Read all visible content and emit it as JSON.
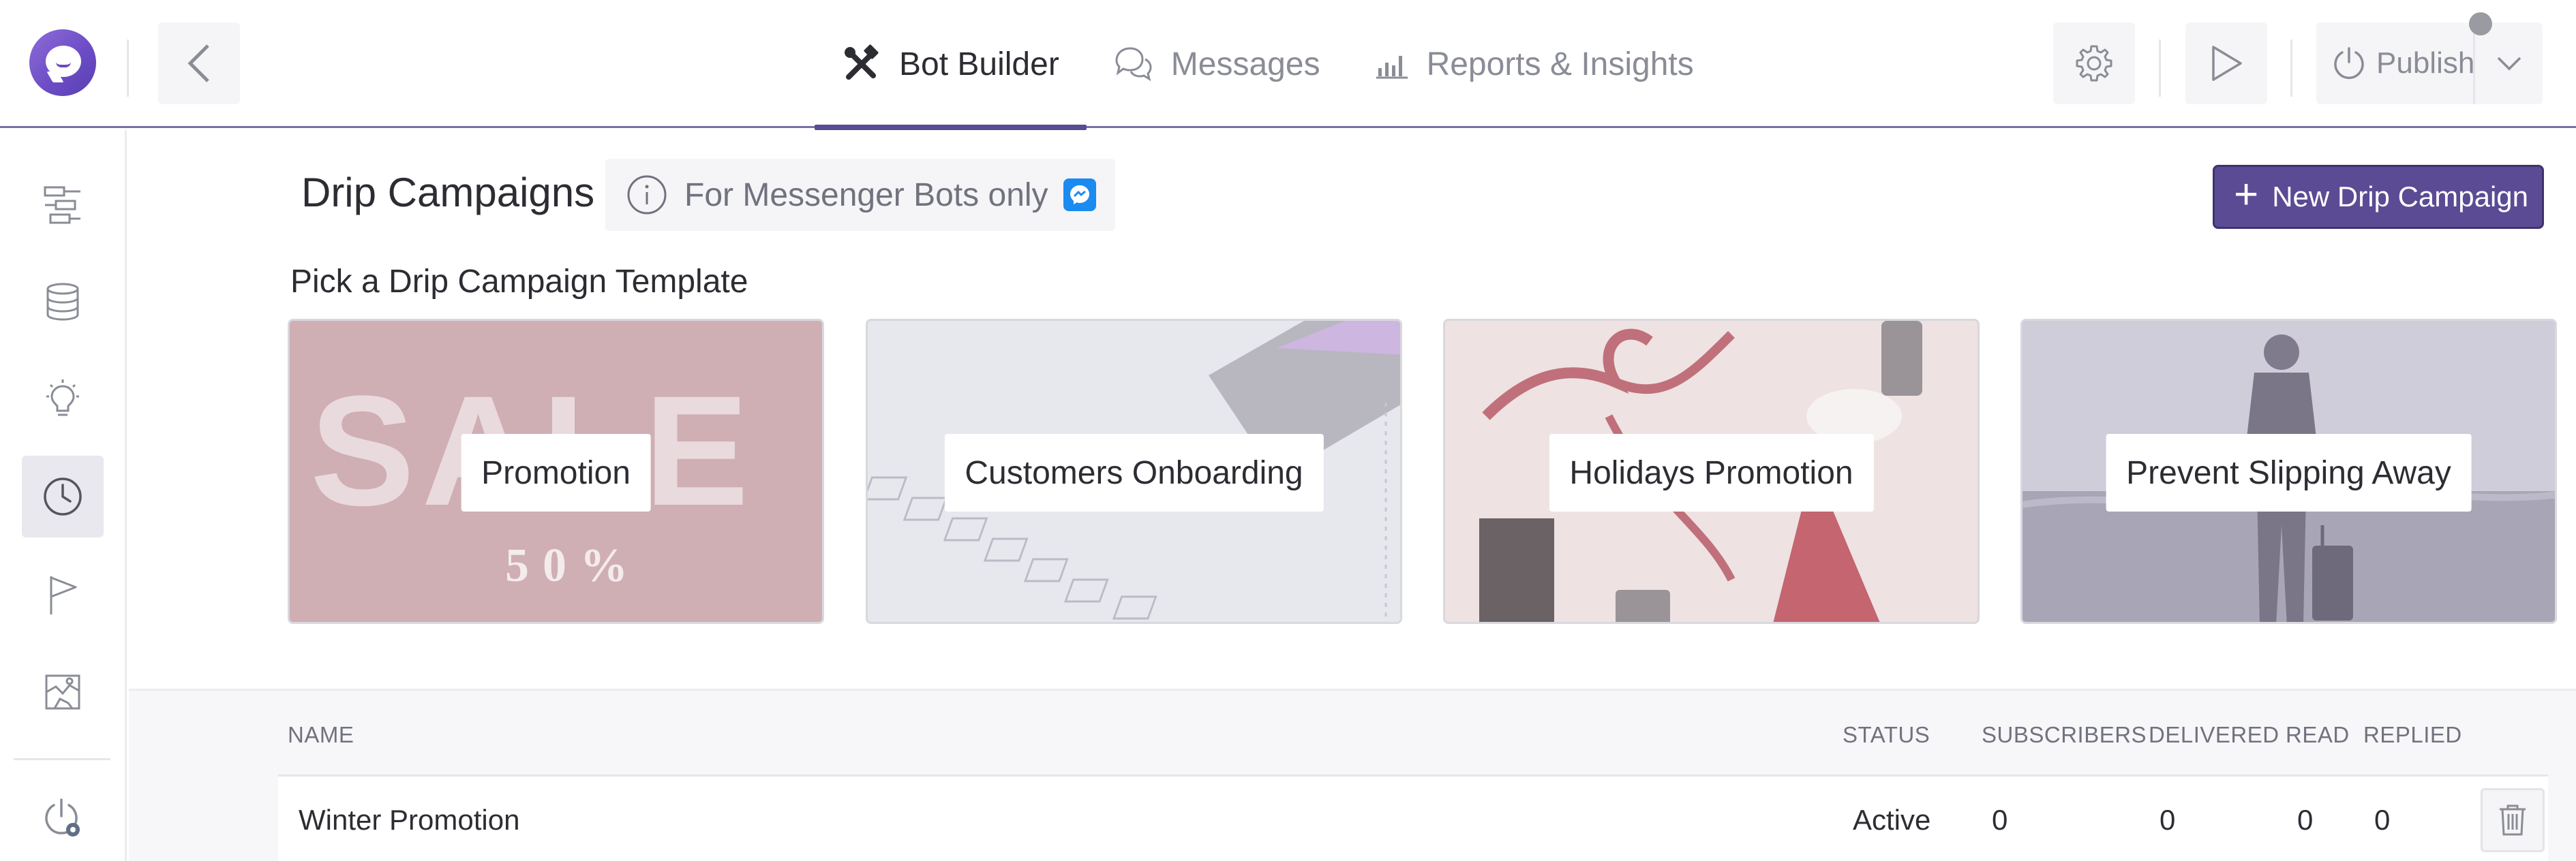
{
  "header": {
    "tabs": [
      {
        "label": "Bot Builder",
        "icon": "tools-icon",
        "active": true
      },
      {
        "label": "Messages",
        "icon": "chat-bubbles-icon",
        "active": false
      },
      {
        "label": "Reports & Insights",
        "icon": "bar-chart-icon",
        "active": false
      }
    ],
    "publish_label": "Publish"
  },
  "sidebar": {
    "items": [
      {
        "icon": "flow-icon",
        "active": false
      },
      {
        "icon": "database-icon",
        "active": false
      },
      {
        "icon": "lightbulb-icon",
        "active": false
      },
      {
        "icon": "clock-icon",
        "active": true
      },
      {
        "icon": "flag-icon",
        "active": false
      },
      {
        "icon": "map-icon",
        "active": false
      },
      {
        "icon": "power-settings-icon",
        "active": false
      }
    ]
  },
  "main": {
    "title": "Drip Campaigns",
    "info_text": "For Messenger Bots only",
    "new_button_label": "New Drip Campaign",
    "templates_heading": "Pick a Drip Campaign Template",
    "templates": [
      {
        "label": "Promotion"
      },
      {
        "label": "Customers Onboarding"
      },
      {
        "label": "Holidays Promotion"
      },
      {
        "label": "Prevent Slipping Away"
      }
    ],
    "template_art": {
      "sale_word": "SALE",
      "sale_percent": "50%"
    }
  },
  "table": {
    "columns": [
      "NAME",
      "STATUS",
      "SUBSCRIBERS",
      "DELIVERED",
      "READ",
      "REPLIED"
    ],
    "rows": [
      {
        "name": "Winter Promotion",
        "status": "Active",
        "subscribers": "0",
        "delivered": "0",
        "read": "0",
        "replied": "0"
      }
    ]
  },
  "colors": {
    "accent": "#5b4b94",
    "messenger": "#1a8bf0",
    "logo": "#7a5cd0"
  }
}
